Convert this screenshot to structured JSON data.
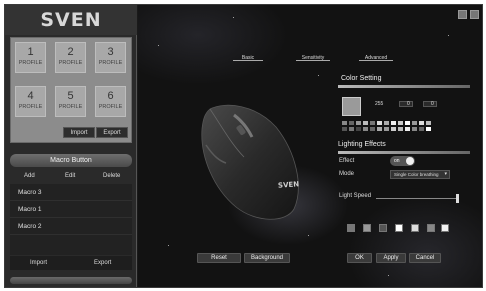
{
  "brand": {
    "logo_text": "SVEN"
  },
  "profiles": [
    {
      "number": "1",
      "label": "PROFILE"
    },
    {
      "number": "2",
      "label": "PROFILE"
    },
    {
      "number": "3",
      "label": "PROFILE"
    },
    {
      "number": "4",
      "label": "PROFILE"
    },
    {
      "number": "5",
      "label": "PROFILE"
    },
    {
      "number": "6",
      "label": "PROFILE"
    }
  ],
  "profile_actions": {
    "import_label": "Import",
    "export_label": "Export"
  },
  "macro": {
    "title": "Macro Button",
    "add_label": "Add",
    "edit_label": "Edit",
    "delete_label": "Delete",
    "items": [
      "Macro 3",
      "Macro 1",
      "Macro 2"
    ],
    "import_label": "Import",
    "export_label": "Export"
  },
  "tabs": {
    "basic": "Basic",
    "sensitivity": "Sensitivity",
    "advanced": "Advanced"
  },
  "mouse": {
    "brand_text": "SVEN"
  },
  "color_setting": {
    "title": "Color Setting",
    "selected_color": "#9a9a9a",
    "r_value": "255",
    "g_value": "0",
    "b_value": "0"
  },
  "lighting": {
    "title": "Lighting Effects",
    "effect_label": "Effect",
    "effect_state": "on",
    "mode_label": "Mode",
    "mode_value": "Single Color breathing",
    "speed_label": "Light Speed",
    "speed_level": 1.0
  },
  "footer": {
    "reset_label": "Reset",
    "background_label": "Background",
    "ok_label": "OK",
    "apply_label": "Apply",
    "cancel_label": "Cancel"
  },
  "icons": {
    "minimize": "minimize-icon",
    "close": "close-icon",
    "dropdown": "chevron-down-icon"
  }
}
